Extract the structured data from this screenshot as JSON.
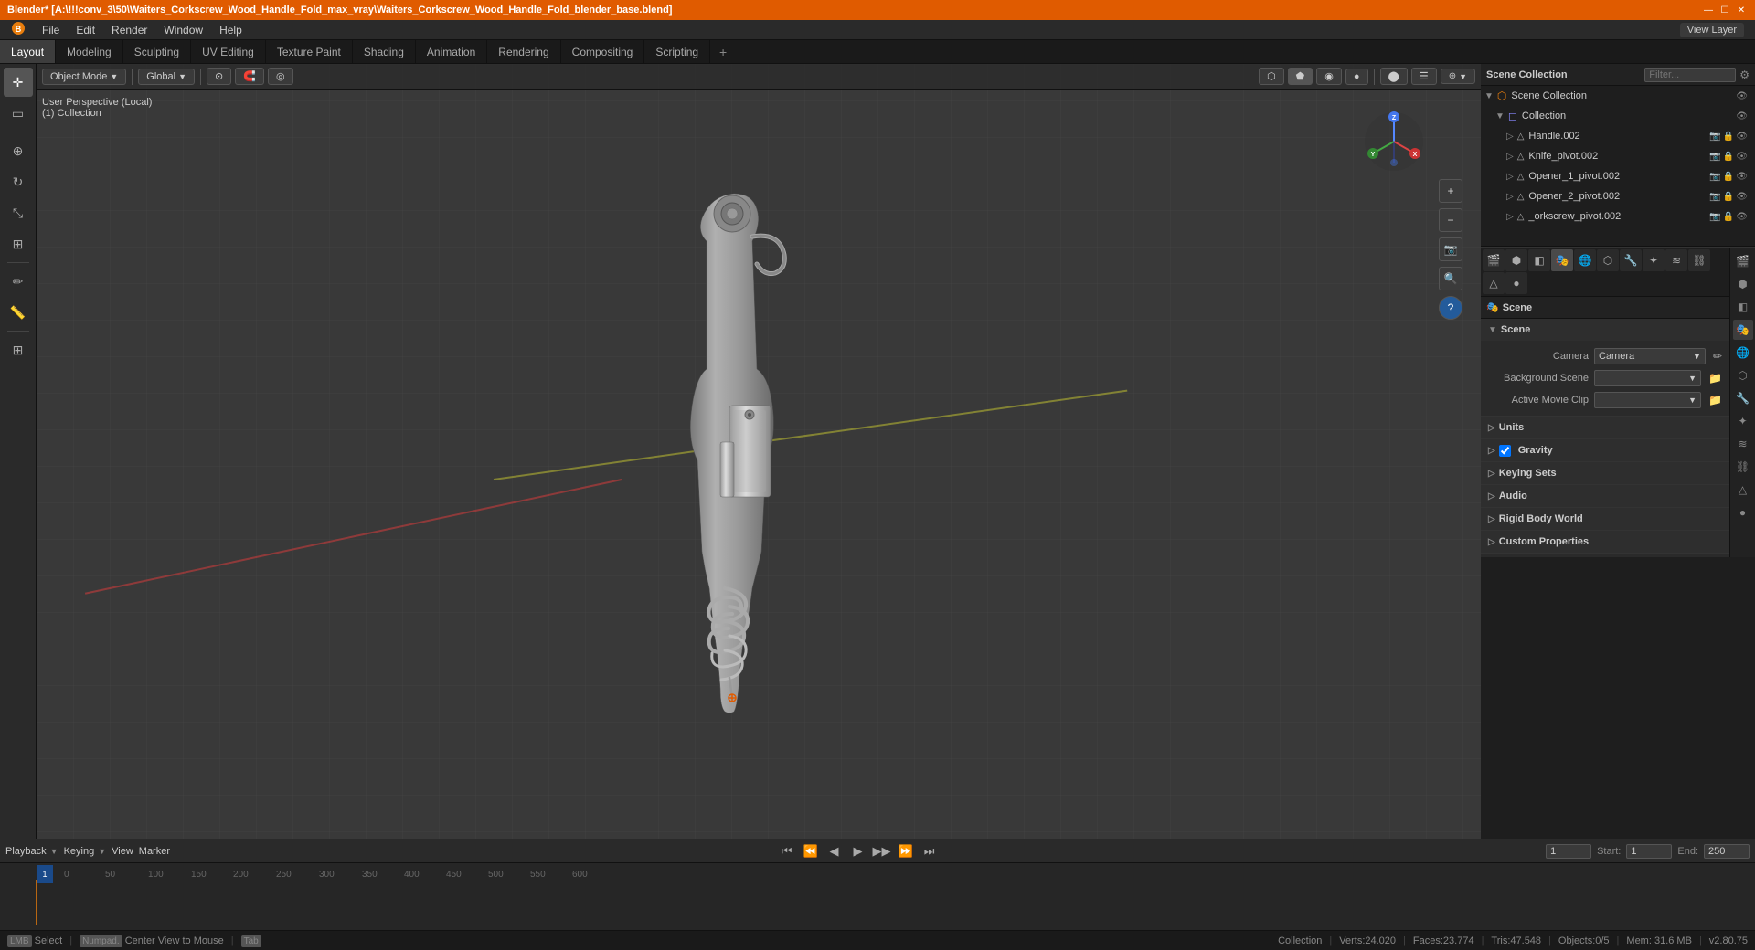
{
  "window": {
    "title": "Blender* [A:\\!!!conv_3\\50\\Waiters_Corkscrew_Wood_Handle_Fold_max_vray\\Waiters_Corkscrew_Wood_Handle_Fold_blender_base.blend]",
    "controls": [
      "—",
      "☐",
      "✕"
    ]
  },
  "menu": {
    "items": [
      "Blender",
      "File",
      "Edit",
      "Render",
      "Window",
      "Help"
    ]
  },
  "workspace_tabs": {
    "tabs": [
      "Layout",
      "Modeling",
      "Sculpting",
      "UV Editing",
      "Texture Paint",
      "Shading",
      "Animation",
      "Rendering",
      "Compositing",
      "Scripting",
      "+"
    ],
    "active": "Layout"
  },
  "viewport": {
    "mode": "Object Mode",
    "view_label": "User Perspective (Local)",
    "collection_label": "(1) Collection",
    "shading_buttons": [
      "▦",
      "◉",
      "⬡",
      "●"
    ],
    "overlays": "Global",
    "toolbar_items": [
      "Object Mode",
      "Global",
      "·|·",
      "Pivot"
    ]
  },
  "left_tools": {
    "tools": [
      "cursor",
      "select",
      "move",
      "rotate",
      "scale",
      "transform",
      "annotate",
      "measure",
      "add",
      "separator",
      "separator2"
    ]
  },
  "outliner": {
    "title": "Scene Collection",
    "items": [
      {
        "name": "Collection",
        "type": "collection",
        "indent": 0,
        "expanded": true
      },
      {
        "name": "Handle.002",
        "type": "mesh",
        "indent": 1,
        "expanded": false
      },
      {
        "name": "Knife_pivot.002",
        "type": "mesh",
        "indent": 1,
        "expanded": false
      },
      {
        "name": "Opener_1_pivot.002",
        "type": "mesh",
        "indent": 1,
        "expanded": false
      },
      {
        "name": "Opener_2_pivot.002",
        "type": "mesh",
        "indent": 1,
        "expanded": false
      },
      {
        "name": "_orkscrew_pivot.002",
        "type": "mesh",
        "indent": 1,
        "expanded": false
      }
    ]
  },
  "scene_properties": {
    "title": "Scene",
    "section_label": "Scene",
    "camera_label": "Camera",
    "camera_value": "",
    "background_scene_label": "Background Scene",
    "active_movie_clip_label": "Active Movie Clip",
    "active_movie_clip_value": "",
    "sections": [
      {
        "label": "Units",
        "expanded": false
      },
      {
        "label": "Gravity",
        "expanded": false,
        "checkbox": true
      },
      {
        "label": "Keying Sets",
        "expanded": false
      },
      {
        "label": "Audio",
        "expanded": false
      },
      {
        "label": "Rigid Body World",
        "expanded": false
      },
      {
        "label": "Custom Properties",
        "expanded": false
      }
    ]
  },
  "props_sidebar_icons": [
    "scene",
    "render",
    "output",
    "view_layer",
    "scene_data",
    "world",
    "object",
    "modifier",
    "particles",
    "physics",
    "constraints",
    "data",
    "material",
    "shading"
  ],
  "timeline": {
    "playback_label": "Playback",
    "keying_label": "Keying",
    "view_label": "View",
    "marker_label": "Marker",
    "frame_current": "1",
    "frame_start_label": "Start:",
    "frame_start": "1",
    "frame_end_label": "End:",
    "frame_end": "250",
    "markers": [
      0,
      50,
      100,
      150,
      200,
      250
    ],
    "numbers": [
      "0",
      "50",
      "100",
      "150",
      "200",
      "250"
    ],
    "playback_controls": [
      "⏮",
      "⏪",
      "◀",
      "▶",
      "▶▶",
      "⏩",
      "⏭"
    ]
  },
  "status_bar": {
    "select_label": "Select",
    "center_view_label": "Center View to Mouse",
    "collection_label": "Collection",
    "verts": "Verts:24.020",
    "faces": "Faces:23.774",
    "tris": "Tris:47.548",
    "objects": "Objects:0/5",
    "mem": "Mem: 31.6 MB",
    "version": "v2.80.75"
  },
  "axis_gizmo": {
    "x_label": "X",
    "y_label": "Y",
    "z_label": "Z"
  }
}
